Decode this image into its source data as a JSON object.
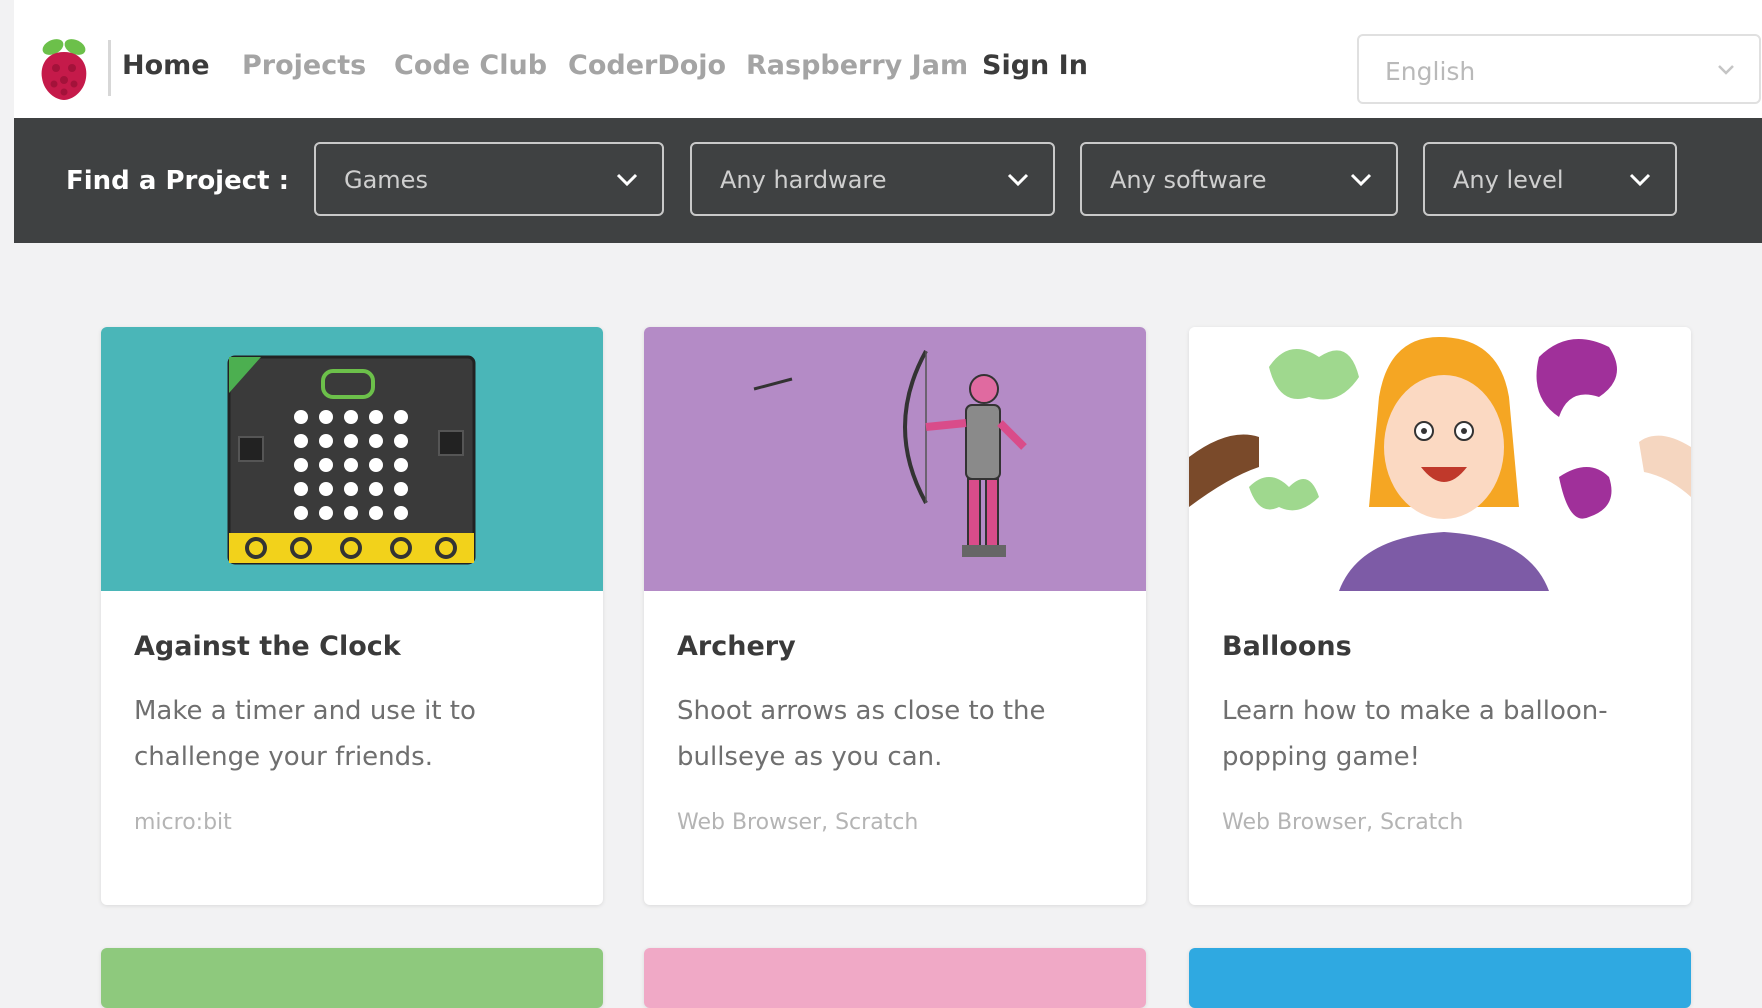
{
  "nav": {
    "links": [
      "Home",
      "Projects",
      "Code Club",
      "CoderDojo",
      "Raspberry Jam"
    ],
    "sign_in": "Sign In",
    "language": "English"
  },
  "filter": {
    "label": "Find a Project :",
    "category": "Games",
    "hardware": "Any hardware",
    "software": "Any software",
    "level": "Any level"
  },
  "projects": [
    {
      "title": "Against the Clock",
      "description": "Make a timer and use it to challenge your friends.",
      "tags": "micro:bit",
      "image_color": "#4ab6b8"
    },
    {
      "title": "Archery",
      "description": "Shoot arrows as close to the bullseye as you can.",
      "tags": "Web Browser, Scratch",
      "image_color": "#b48bc6"
    },
    {
      "title": "Balloons",
      "description": "Learn how to make a balloon-popping game!",
      "tags": "Web Browser, Scratch",
      "image_color": "#ffffff"
    }
  ],
  "row2_colors": [
    "#8ec97d",
    "#f0a9c6",
    "#2fa9e1"
  ],
  "colors": {
    "filter_bar": "#3f4142",
    "nav_active": "#3b3b3b",
    "nav_inactive": "#a4a4a4",
    "raspberry": "#c51a4a",
    "leaf": "#6cc04a"
  }
}
